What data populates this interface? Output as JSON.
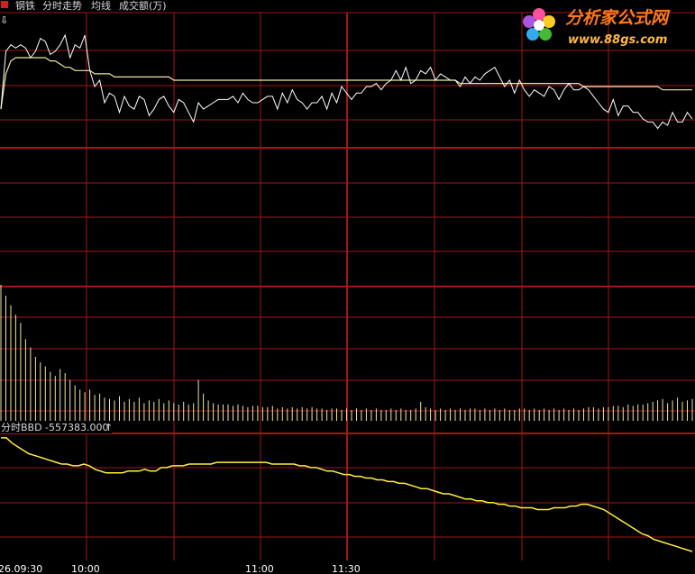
{
  "header": {
    "stock_name": "钢铁",
    "chart_title": "分时走势",
    "avg_label": "均线",
    "volume_label": "成交额(万)"
  },
  "indicator": {
    "name": "分时BBD",
    "value": "-557383.000",
    "arrow": "↑"
  },
  "time_axis": {
    "ticks": [
      "26.09:30",
      "10:00",
      "11:00",
      "11:30"
    ]
  },
  "logo": {
    "title": "分析家公式网",
    "url": "www.88gs.com"
  },
  "colors": {
    "background": "#000000",
    "grid": "#a01818",
    "price_line": "#ffffff",
    "avg_line": "#f0e6a0",
    "volume_bars": "#f0e6a0",
    "bbd_line": "#ffee44",
    "logo_text": "#ff7a1a"
  },
  "chart_data": [
    {
      "type": "line",
      "series": [
        {
          "values": [
            101.6,
            103.4,
            103.6,
            103.5,
            103.6,
            103.5,
            103.2,
            103.4,
            103.8,
            103.7,
            103.3,
            103.4,
            103.6,
            103.9,
            103.2,
            103.6,
            103.5,
            103.9,
            102.8,
            102.3,
            102.5,
            101.8,
            102.1,
            102.0,
            101.5,
            102.0,
            101.7,
            101.6,
            102.0,
            101.9,
            101.4,
            101.6,
            101.9,
            102.0,
            101.7,
            101.5,
            101.9,
            101.8,
            101.5,
            101.2,
            101.8,
            101.6,
            101.7,
            101.8,
            101.9,
            101.9,
            101.9,
            102.0,
            101.8,
            102.1,
            101.9,
            101.8,
            101.8,
            101.9,
            102.0,
            102.0,
            101.6,
            102.1,
            101.8,
            102.2,
            101.9,
            101.8,
            101.6,
            101.8,
            101.8,
            102.0,
            101.6,
            102.1,
            101.8,
            102.3,
            102.1,
            101.9,
            102.1,
            102.1,
            102.3,
            102.3,
            102.4,
            102.2,
            102.4,
            102.5,
            102.8,
            102.5,
            102.9,
            102.4,
            102.5,
            102.8,
            102.7,
            102.9,
            102.5,
            102.7,
            102.6,
            102.5,
            102.5,
            102.3,
            102.6,
            102.4,
            102.6,
            102.5,
            102.7,
            102.8,
            102.9,
            102.6,
            102.3,
            102.5,
            102.1,
            102.5,
            102.2,
            102.0,
            102.2,
            102.1,
            102.0,
            102.3,
            102.2,
            101.9,
            102.2,
            102.4,
            102.2,
            102.2,
            102.3,
            102.2,
            102.0,
            101.8,
            101.6,
            101.5,
            101.9,
            101.4,
            101.7,
            101.7,
            101.5,
            101.5,
            101.3,
            101.2,
            101.2,
            101.0,
            101.2,
            101.1,
            101.5,
            101.2,
            101.2,
            101.5,
            101.3
          ]
        },
        {
          "values": [
            101.6,
            102.7,
            103.1,
            103.2,
            103.2,
            103.2,
            103.2,
            103.2,
            103.2,
            103.2,
            103.1,
            103.1,
            103.0,
            102.9,
            102.9,
            102.8,
            102.8,
            102.8,
            102.8,
            102.7,
            102.7,
            102.7,
            102.7,
            102.6,
            102.6,
            102.6,
            102.6,
            102.6,
            102.6,
            102.6,
            102.6,
            102.6,
            102.6,
            102.6,
            102.6,
            102.5,
            102.5,
            102.5,
            102.5,
            102.5,
            102.5,
            102.5,
            102.5,
            102.5,
            102.5,
            102.5,
            102.5,
            102.5,
            102.5,
            102.5,
            102.5,
            102.5,
            102.5,
            102.5,
            102.5,
            102.5,
            102.5,
            102.5,
            102.5,
            102.5,
            102.5,
            102.5,
            102.5,
            102.5,
            102.5,
            102.5,
            102.5,
            102.5,
            102.5,
            102.5,
            102.5,
            102.5,
            102.5,
            102.5,
            102.5,
            102.5,
            102.5,
            102.5,
            102.5,
            102.5,
            102.5,
            102.5,
            102.5,
            102.5,
            102.5,
            102.5,
            102.5,
            102.5,
            102.5,
            102.5,
            102.5,
            102.5,
            102.5,
            102.4,
            102.4,
            102.4,
            102.4,
            102.4,
            102.4,
            102.4,
            102.4,
            102.4,
            102.4,
            102.4,
            102.4,
            102.4,
            102.4,
            102.4,
            102.4,
            102.4,
            102.4,
            102.4,
            102.4,
            102.4,
            102.4,
            102.4,
            102.4,
            102.4,
            102.3,
            102.3,
            102.3,
            102.3,
            102.3,
            102.3,
            102.3,
            102.3,
            102.3,
            102.3,
            102.3,
            102.3,
            102.3,
            102.3,
            102.3,
            102.3,
            102.2,
            102.2,
            102.2,
            102.2,
            102.2,
            102.2,
            102.2
          ]
        }
      ]
    },
    {
      "type": "bar",
      "values": [
        100,
        92,
        85,
        78,
        72,
        60,
        54,
        47,
        43,
        40,
        36,
        33,
        38,
        35,
        30,
        26,
        23,
        21,
        23,
        19,
        20,
        17,
        16,
        15,
        18,
        14,
        16,
        14,
        17,
        13,
        15,
        14,
        16,
        13,
        15,
        13,
        12,
        14,
        12,
        13,
        30,
        20,
        15,
        13,
        12,
        12,
        12,
        11,
        12,
        11,
        10,
        11,
        11,
        10,
        10,
        11,
        9,
        10,
        9,
        10,
        9,
        10,
        9,
        10,
        9,
        9,
        8,
        9,
        9,
        8,
        9,
        8,
        9,
        8,
        9,
        8,
        9,
        8,
        8,
        9,
        8,
        9,
        8,
        8,
        9,
        14,
        10,
        9,
        8,
        9,
        8,
        9,
        8,
        9,
        8,
        9,
        9,
        8,
        9,
        8,
        9,
        8,
        9,
        8,
        8,
        9,
        9,
        8,
        9,
        8,
        9,
        8,
        9,
        8,
        9,
        8,
        9,
        8,
        9,
        10,
        10,
        9,
        10,
        10,
        11,
        11,
        10,
        12,
        11,
        12,
        12,
        13,
        14,
        15,
        16,
        13,
        15,
        17,
        14,
        15,
        16
      ]
    },
    {
      "type": "line",
      "values": [
        -5,
        -5,
        -8,
        -10,
        -12,
        -14,
        -15,
        -16,
        -17,
        -18,
        -19,
        -20,
        -20,
        -21,
        -21,
        -20,
        -21,
        -23,
        -24,
        -25,
        -25,
        -25,
        -25,
        -24,
        -24,
        -24,
        -23,
        -24,
        -24,
        -22,
        -22,
        -21,
        -21,
        -21,
        -20,
        -20,
        -20,
        -20,
        -20,
        -19,
        -19,
        -19,
        -19,
        -19,
        -19,
        -19,
        -19,
        -19,
        -19,
        -20,
        -20,
        -20,
        -20,
        -20,
        -21,
        -21,
        -22,
        -22,
        -23,
        -24,
        -24,
        -25,
        -26,
        -26,
        -27,
        -27,
        -28,
        -28,
        -29,
        -29,
        -30,
        -30,
        -31,
        -31,
        -32,
        -33,
        -34,
        -34,
        -35,
        -36,
        -37,
        -37,
        -38,
        -39,
        -40,
        -40,
        -41,
        -41,
        -42,
        -42,
        -43,
        -43,
        -44,
        -44,
        -45,
        -45,
        -45,
        -46,
        -46,
        -46,
        -45,
        -45,
        -45,
        -44,
        -44,
        -43,
        -43,
        -44,
        -45,
        -46,
        -48,
        -50,
        -52,
        -54,
        -56,
        -58,
        -60,
        -61,
        -63,
        -64,
        -65,
        -66,
        -67,
        -68,
        -69,
        -70
      ]
    }
  ]
}
